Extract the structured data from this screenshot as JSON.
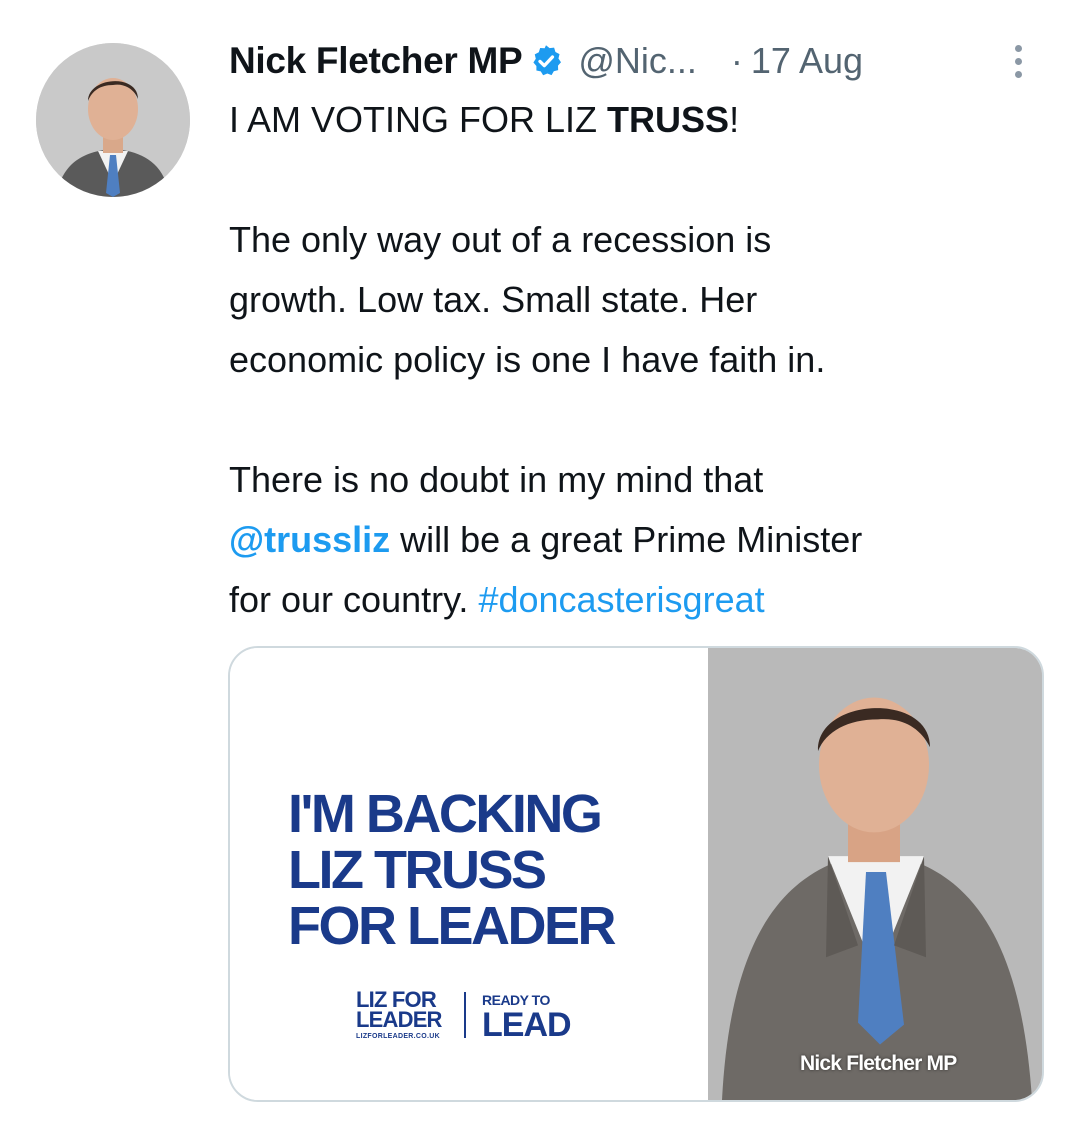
{
  "tweet": {
    "author": {
      "display_name": "Nick Fletcher MP",
      "handle": "@Nic...",
      "verified_icon": "verified-badge-icon"
    },
    "separator": "·",
    "date": "17 Aug",
    "more_icon": "more-options-icon",
    "line1_prefix": "I AM VOTING FOR LIZ ",
    "line1_bold": "TRUSS",
    "line1_suffix": "!",
    "p2_lines": [
      "The only way out of a recession is",
      "growth. Low tax. Small state. Her",
      "economic policy is one I have faith in."
    ],
    "p3_line1": "There is no doubt in my mind that",
    "mention": "@trussliz",
    "p3_line2_rest": " will be a great Prime Minister",
    "p3_line3_prefix": "for our country.  ",
    "hashtag": "#doncasterisgreat"
  },
  "media": {
    "headline": [
      "I'M BACKING",
      "LIZ TRUSS",
      "FOR LEADER"
    ],
    "logo_left_lines": [
      "LIZ FOR",
      "LEADER"
    ],
    "logo_url": "LIZFORLEADER.CO.UK",
    "logo_right_small": "READY TO",
    "logo_right_big": "LEAD",
    "caption": "Nick Fletcher MP"
  },
  "colors": {
    "link": "#1d9bf0",
    "text": "#0f1419",
    "secondary": "#536471",
    "brand_navy": "#1a3a8a",
    "verified": "#1d9bf0"
  }
}
